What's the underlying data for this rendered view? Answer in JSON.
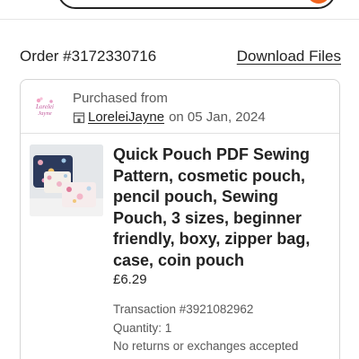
{
  "colors": {
    "accent": "#f1641e",
    "text": "#222222",
    "muted": "#595959",
    "border": "#d6d6d6"
  },
  "order": {
    "number_text": "Order #3172330716",
    "download_label": "Download Files"
  },
  "shop": {
    "purchased_from_label": "Purchased from",
    "logo_text": "Lorelei Jayne",
    "shop_icon": "store-icon",
    "name": "LoreleiJayne",
    "date_text": "on 05 Jan, 2024"
  },
  "product": {
    "title": "Quick Pouch PDF Sewing Pattern, cosmetic pouch, pencil pouch, Sewing Pouch, 3 sizes, beginner friendly, boxy, zipper bag, case, coin pouch",
    "price": "£6.29",
    "transaction_text": "Transaction #3921082962",
    "quantity_text": "Quantity: 1",
    "returns_text": "No returns or exchanges accepted"
  }
}
